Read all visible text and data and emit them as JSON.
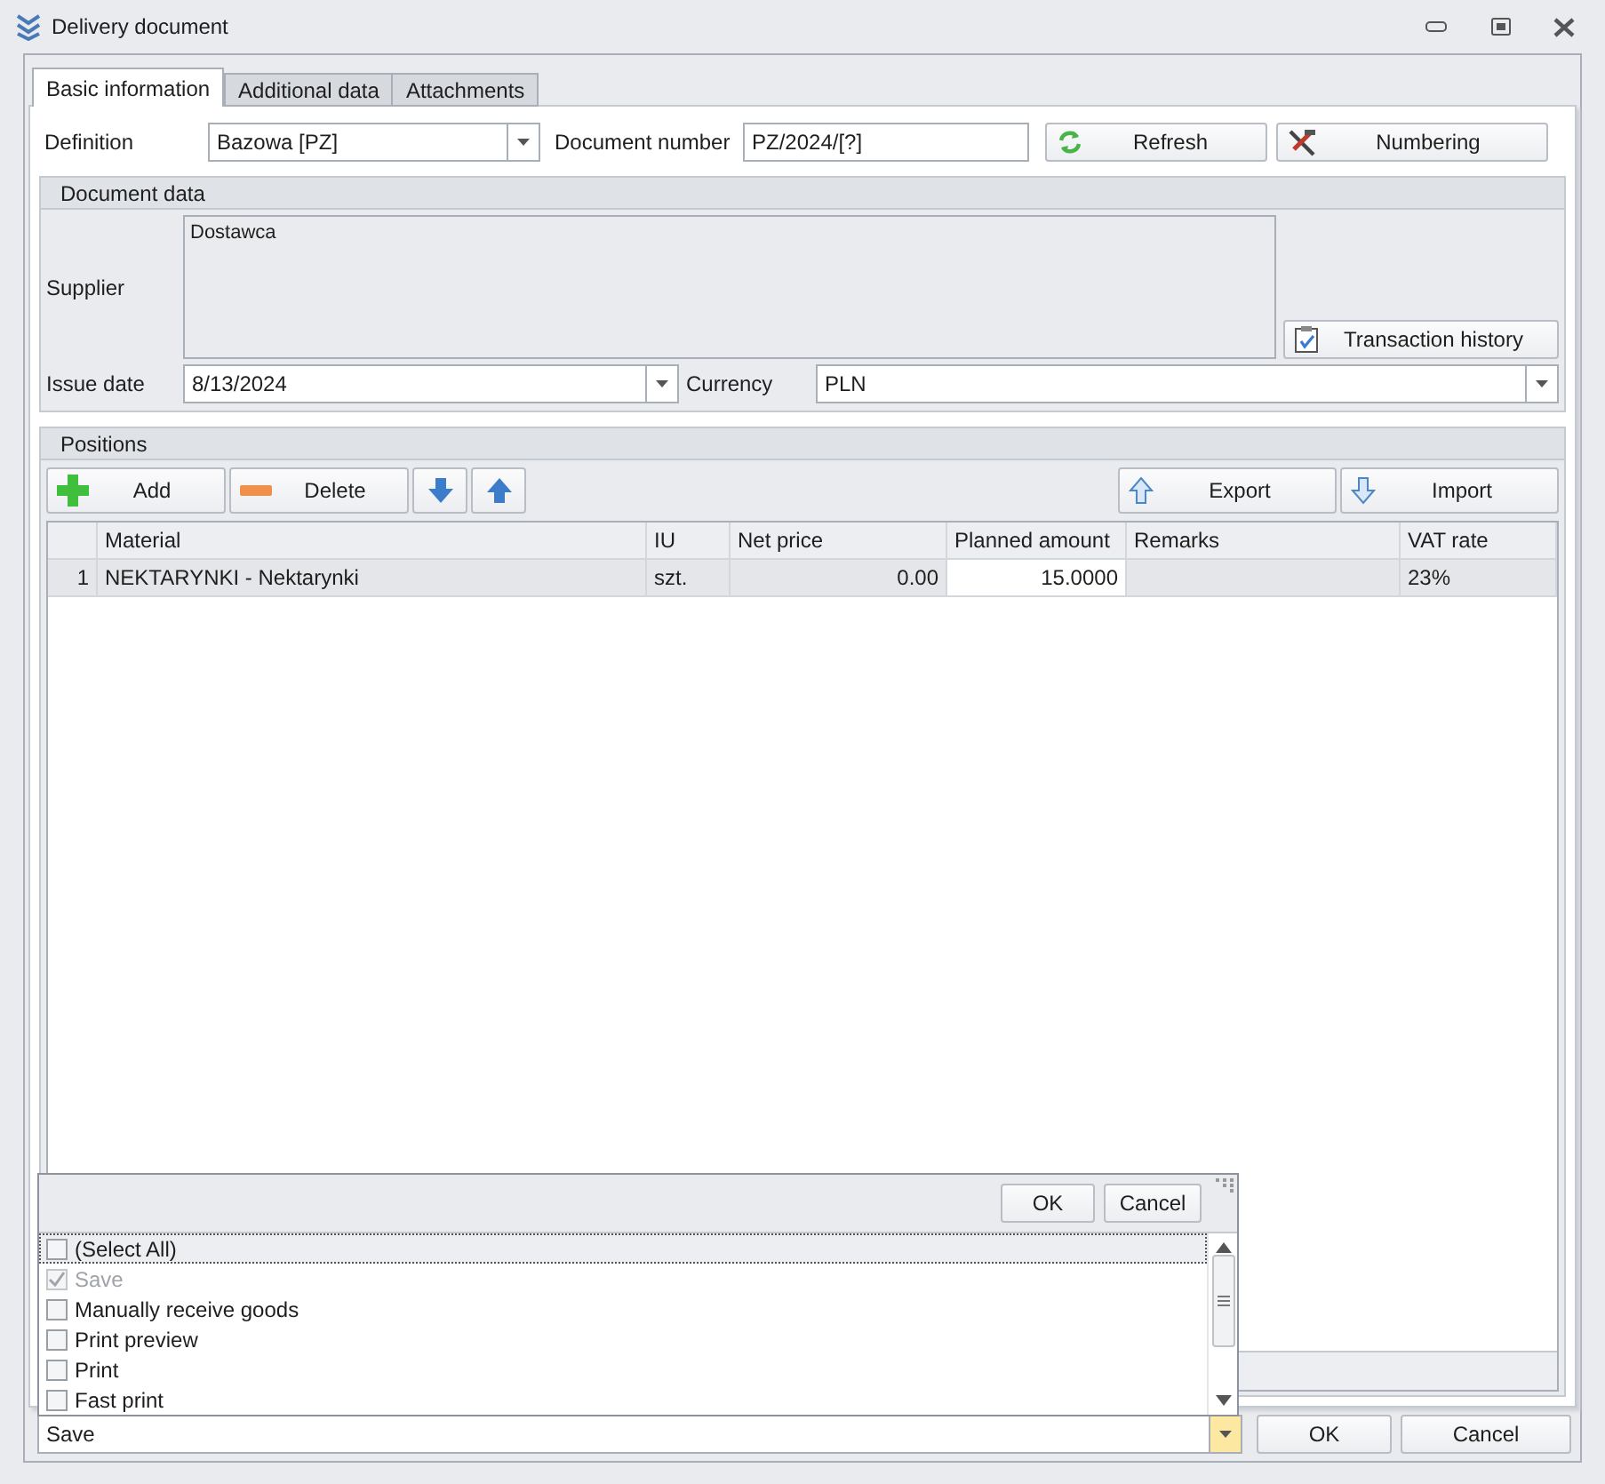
{
  "window": {
    "title": "Delivery document"
  },
  "tabs": [
    {
      "label": "Basic information",
      "selected": true
    },
    {
      "label": "Additional data",
      "selected": false
    },
    {
      "label": "Attachments",
      "selected": false
    }
  ],
  "definition": {
    "label": "Definition",
    "value": "Bazowa [PZ]"
  },
  "document_number": {
    "label": "Document number",
    "value": "PZ/2024/[?]"
  },
  "header_buttons": [
    {
      "kind": "refresh",
      "label": "Refresh"
    },
    {
      "kind": "numbering",
      "label": "Numbering"
    }
  ],
  "document_data": {
    "title": "Document data",
    "supplier": {
      "label": "Supplier",
      "value": "Dostawca"
    },
    "history_button": {
      "label": "Transaction history"
    },
    "issue_date": {
      "label": "Issue date",
      "value": "8/13/2024"
    },
    "currency": {
      "label": "Currency",
      "value": "PLN"
    }
  },
  "positions": {
    "title": "Positions",
    "left_buttons": [
      {
        "kind": "add",
        "label": "Add"
      },
      {
        "kind": "delete",
        "label": "Delete"
      },
      {
        "kind": "down"
      },
      {
        "kind": "up"
      }
    ],
    "right_buttons": [
      {
        "kind": "export",
        "label": "Export"
      },
      {
        "kind": "import",
        "label": "Import"
      }
    ],
    "table": {
      "columns": [
        "Material",
        "IU",
        "Net price",
        "Planned amount",
        "Remarks",
        "VAT rate"
      ],
      "rows": [
        {
          "number": "1",
          "selected": true,
          "cells": [
            {
              "text": "NEKTARYNKI - Nektarynki",
              "focused": false
            },
            {
              "text": "szt.",
              "focused": false
            },
            {
              "text": "0.00",
              "focused": false
            },
            {
              "text": "15.0000",
              "focused": true
            },
            {
              "text": "",
              "focused": false
            },
            {
              "text": "23%",
              "focused": false
            }
          ]
        }
      ]
    }
  },
  "action_combo": {
    "value": "Save"
  },
  "popup": {
    "buttons": [
      "OK",
      "Cancel"
    ],
    "items": [
      {
        "label": "(Select All)",
        "checked": false,
        "disabled": false,
        "selected": true
      },
      {
        "label": "Save",
        "checked": true,
        "disabled": true,
        "selected": false
      },
      {
        "label": "Manually receive goods",
        "checked": false,
        "disabled": false,
        "selected": false
      },
      {
        "label": "Print preview",
        "checked": false,
        "disabled": false,
        "selected": false
      },
      {
        "label": "Print",
        "checked": false,
        "disabled": false,
        "selected": false
      },
      {
        "label": "Fast print",
        "checked": false,
        "disabled": false,
        "selected": false
      }
    ]
  },
  "footer_buttons": [
    "OK",
    "Cancel"
  ]
}
